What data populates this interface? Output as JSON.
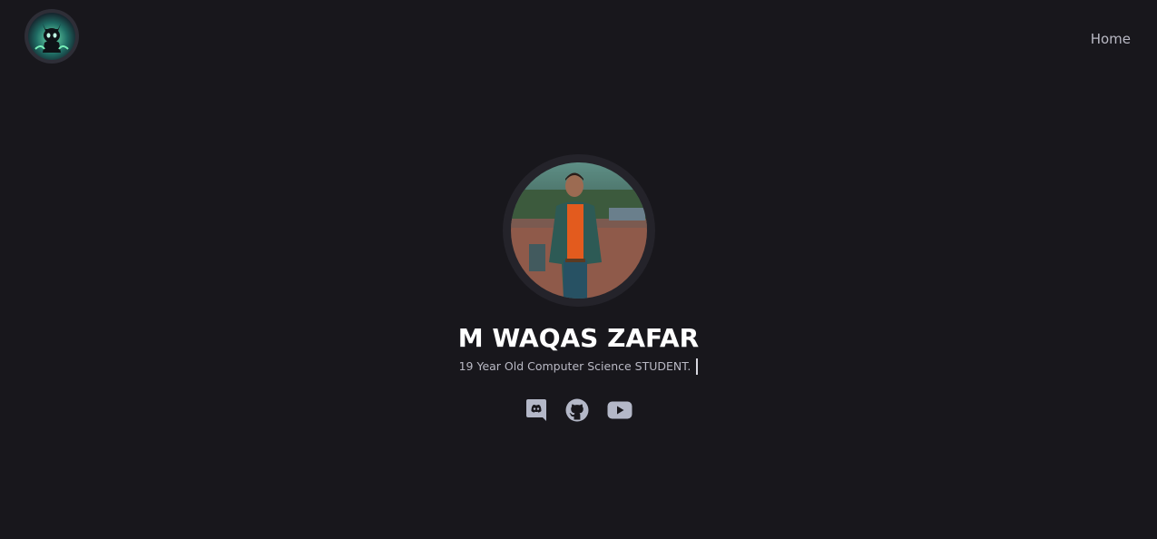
{
  "header": {
    "logo_alt": "site-logo",
    "nav": {
      "home_label": "Home"
    }
  },
  "hero": {
    "name": "M WAQAS ZAFAR",
    "tagline": "19 Year Old Computer Science STUDENT."
  },
  "socials": [
    {
      "icon": "discord-icon"
    },
    {
      "icon": "github-icon"
    },
    {
      "icon": "youtube-icon"
    }
  ],
  "colors": {
    "background": "#18171c",
    "text_primary": "#ffffff",
    "text_muted": "#b9b9c4",
    "icon": "#b4b8c8"
  }
}
